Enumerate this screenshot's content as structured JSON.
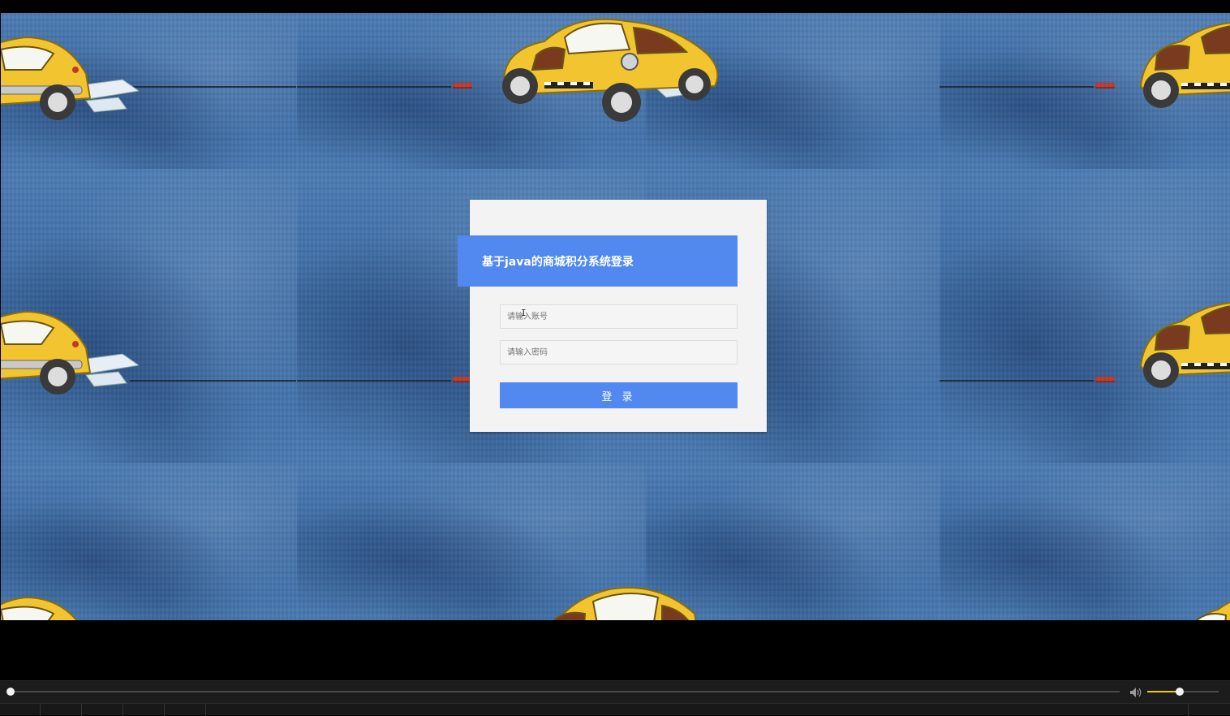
{
  "login": {
    "title": "基于java的商城积分系统登录",
    "account_placeholder": "请输入账号",
    "password_placeholder": "请输入密码",
    "login_button_label": "登 录"
  },
  "player": {
    "progress_fraction": 0.0,
    "volume_fraction": 0.45,
    "volume_icon": "speaker-icon",
    "accent_color": "#f5c518"
  },
  "colors": {
    "primary": "#5189f0",
    "panel_bg": "#f3f3f3",
    "background_blue": "#3f6ea6"
  }
}
